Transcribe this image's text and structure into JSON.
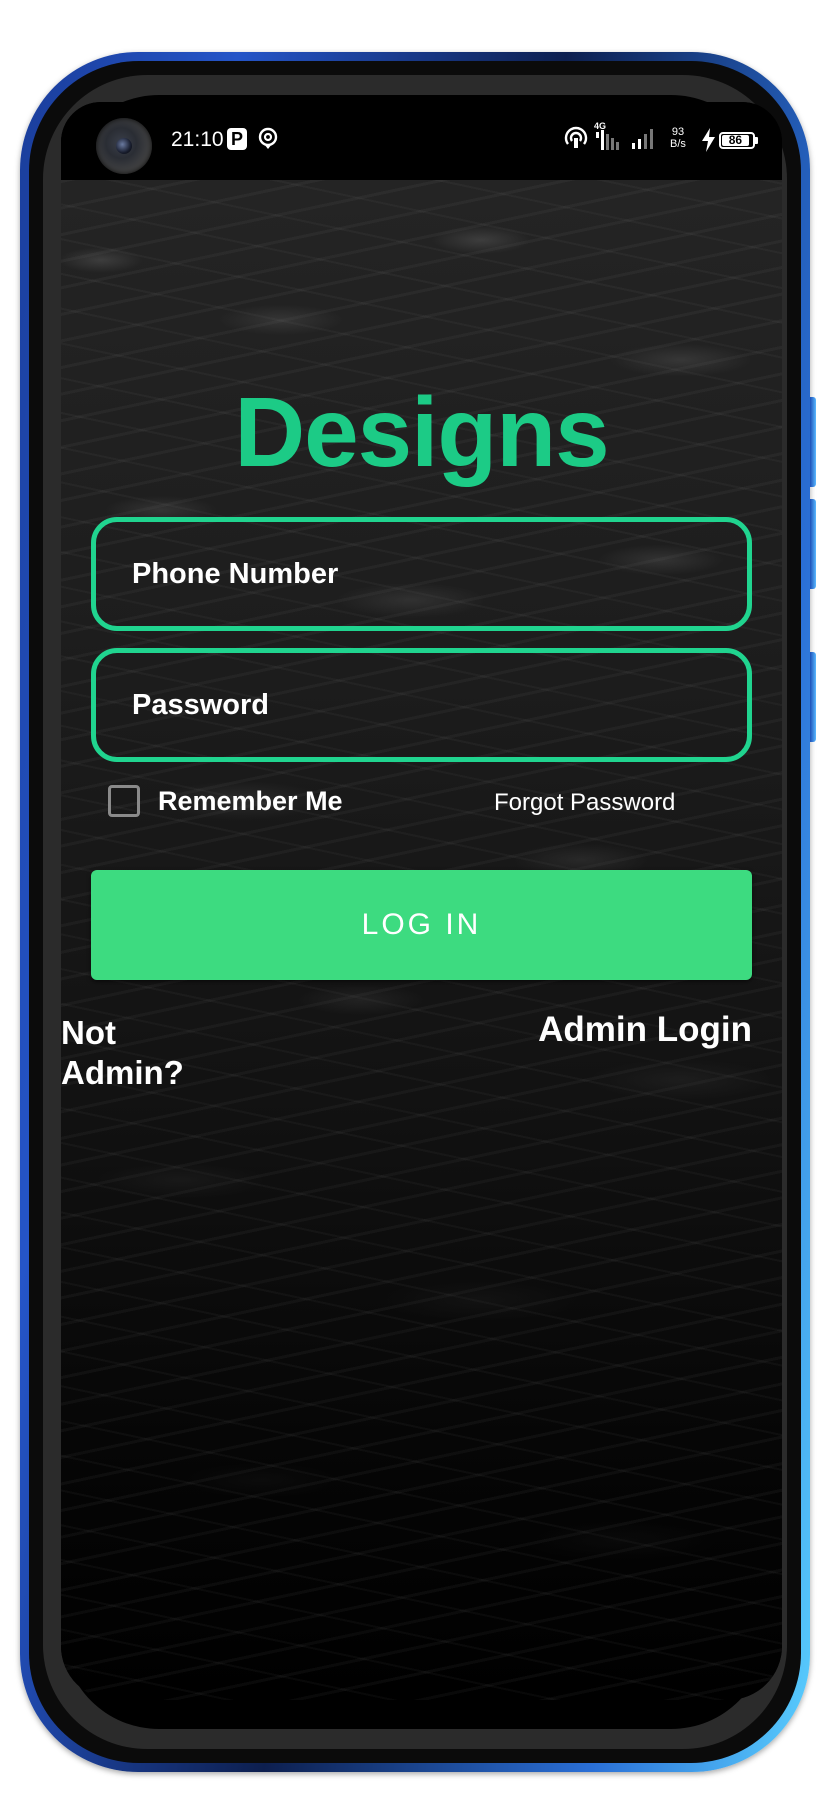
{
  "status_bar": {
    "time": "21:10",
    "p_icon_letter": "P",
    "net_speed_value": "93",
    "net_speed_unit": "B/s",
    "network_type": "4G",
    "battery_level": "86"
  },
  "app": {
    "title": "Designs",
    "phone_field": {
      "placeholder": "Phone Number"
    },
    "password_field": {
      "placeholder": "Password"
    },
    "remember_me_label": "Remember Me",
    "remember_me_checked": false,
    "forgot_password_label": "Forgot Password",
    "login_button_label": "LOG IN",
    "not_admin_label": "Not Admin?",
    "admin_login_label": "Admin Login"
  },
  "colors": {
    "accent_green": "#1ccb86",
    "field_border": "#20d48f",
    "button_green": "#3ddb80",
    "phone_frame": "#1a3d9a"
  }
}
